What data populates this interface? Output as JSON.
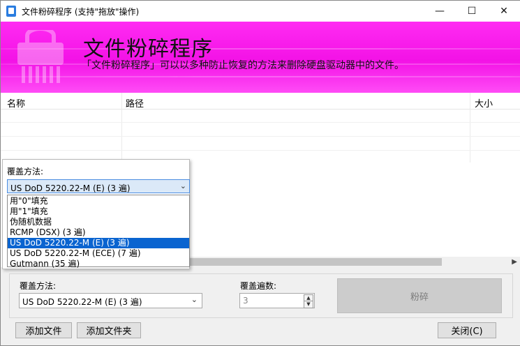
{
  "window": {
    "title": "文件粉碎程序 (支持\"拖放\"操作)",
    "controls": {
      "minimize": "—",
      "maximize": "☐",
      "close": "✕"
    }
  },
  "banner": {
    "title": "文件粉碎程序",
    "description": "「文件粉碎程序」可以以多种防止恢复的方法来删除硬盘驱动器中的文件。",
    "background_color": "#f312e6"
  },
  "file_list": {
    "columns": [
      "名称",
      "路径",
      "大小"
    ]
  },
  "overwrite_popup": {
    "label": "覆盖方法:",
    "selected": "US DoD 5220.22-M (E) (3 遍)",
    "options": [
      "用\"0\"填充",
      "用\"1\"填充",
      "伪随机数据",
      "RCMP (DSX) (3 遍)",
      "US DoD 5220.22-M (E) (3 遍)",
      "US DoD 5220.22-M (ECE) (7 遍)",
      "Gutmann (35 遍)"
    ],
    "highlighted_index": 4
  },
  "options_group": {
    "method_label": "覆盖方法:",
    "method_value": "US DoD 5220.22-M (E) (3 遍)",
    "passes_label": "覆盖遍数:",
    "passes_value": "3",
    "shred_button": "粉碎"
  },
  "footer": {
    "add_file": "添加文件",
    "add_folder": "添加文件夹",
    "close": "关闭(C)"
  }
}
